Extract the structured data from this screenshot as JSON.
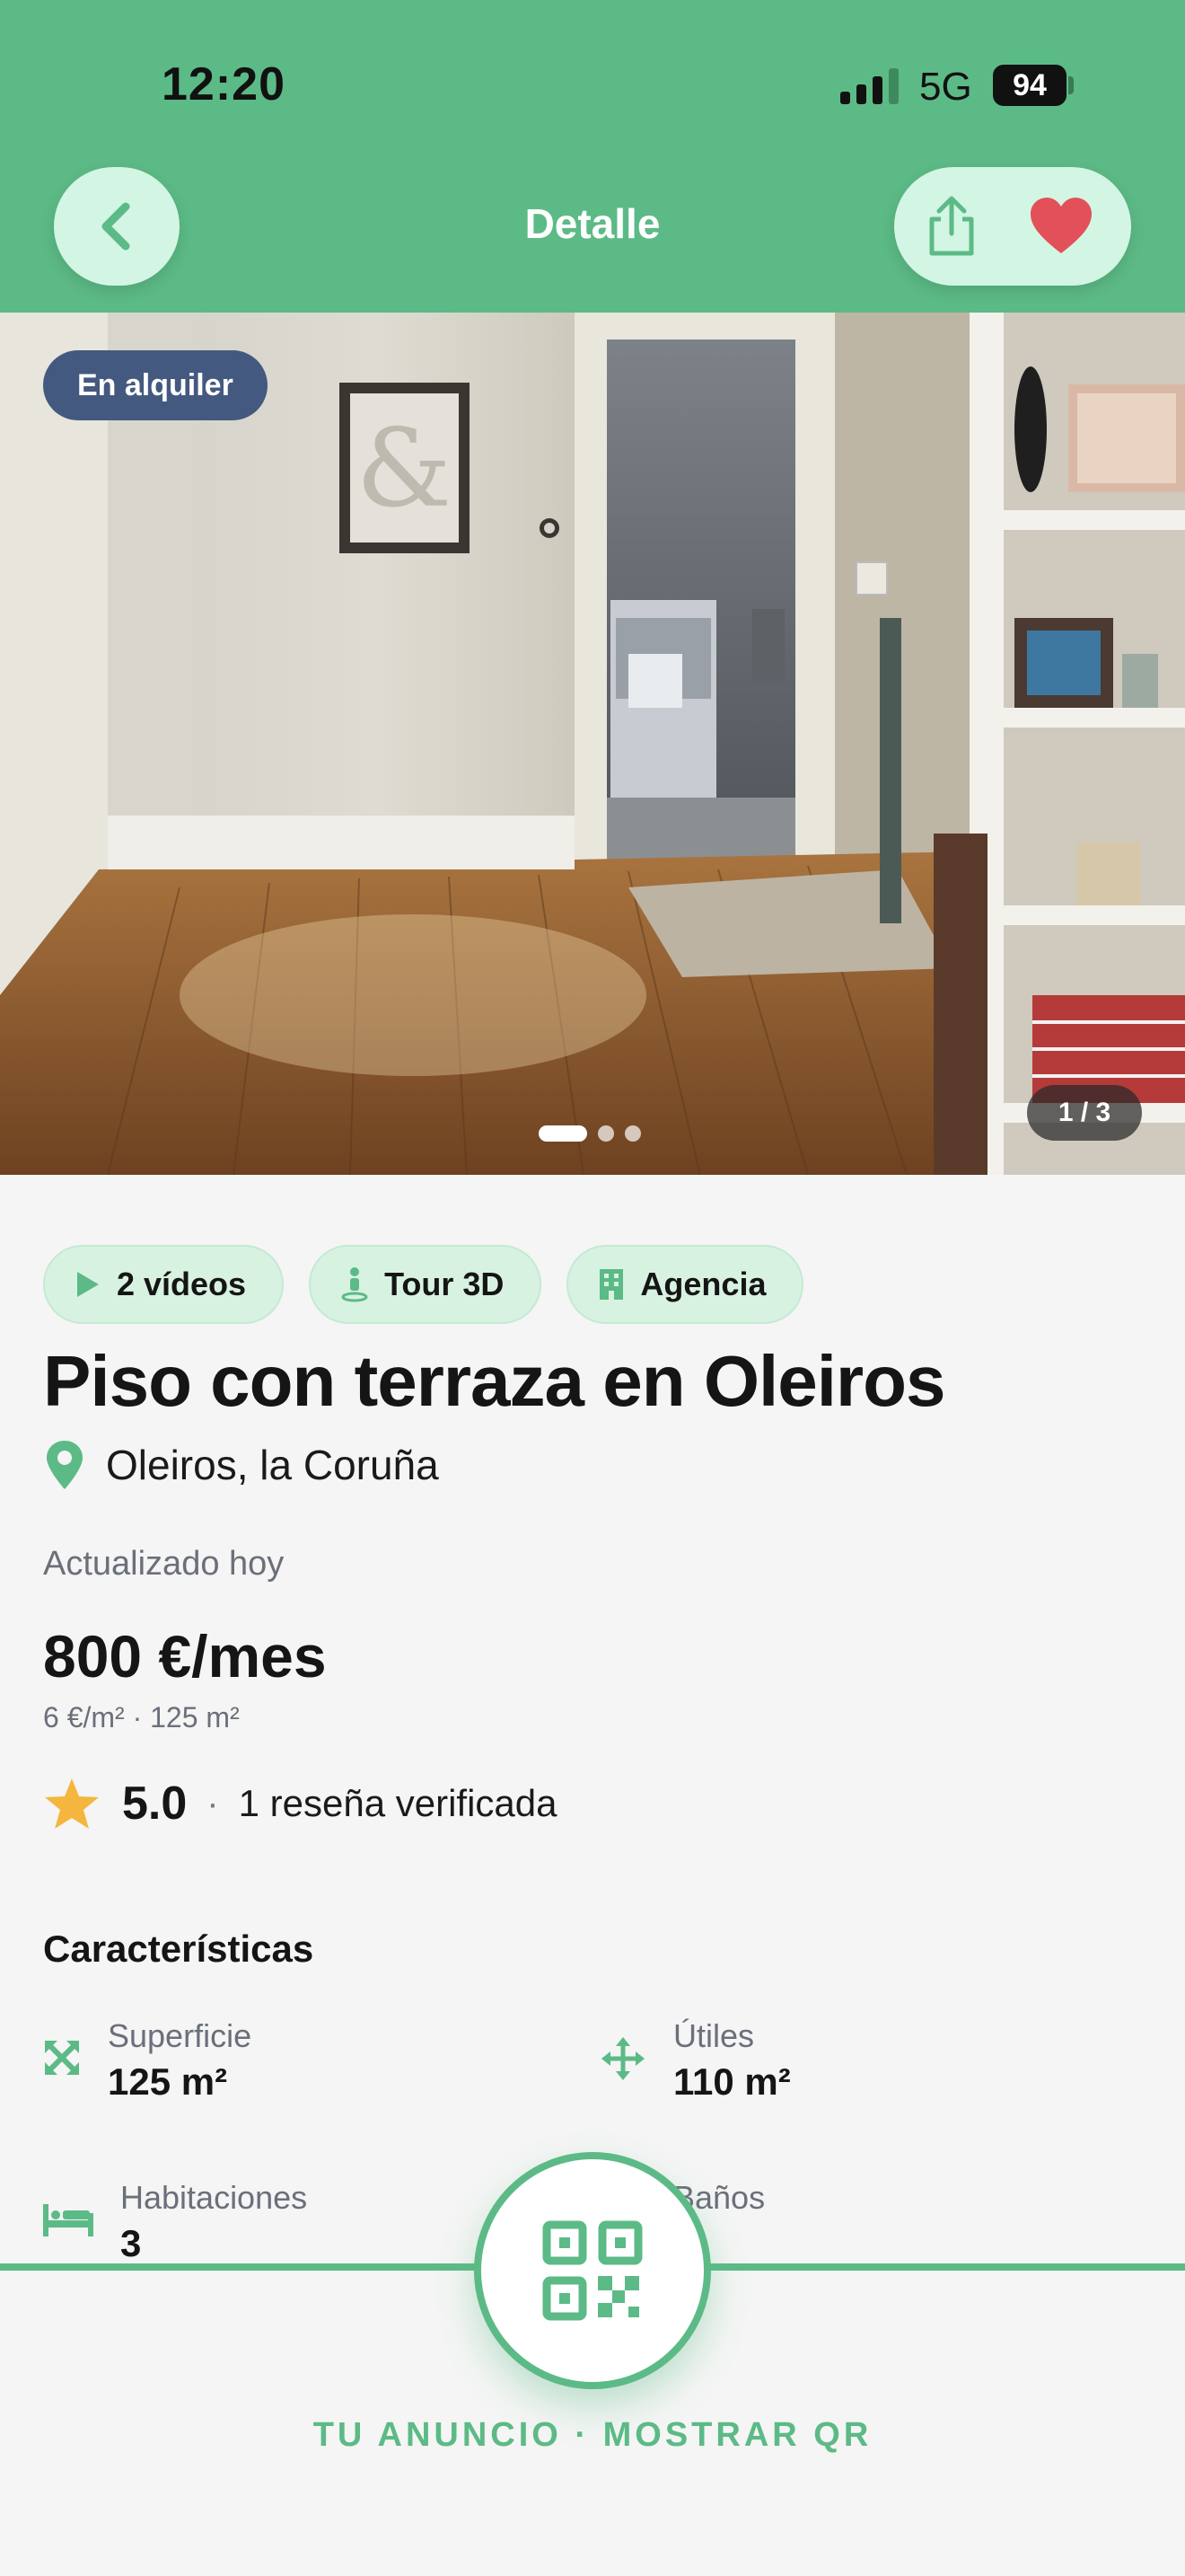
{
  "status_bar": {
    "time": "12:20",
    "network": "5G",
    "battery": "94"
  },
  "header": {
    "title": "Detalle",
    "back_icon": "chevron-left-icon",
    "share_icon": "share-icon",
    "favorite_icon": "heart-icon"
  },
  "gallery": {
    "badge": "En alquiler",
    "counter": "1 / 3",
    "current_index": 1,
    "total": 3
  },
  "chips": [
    {
      "icon": "play-icon",
      "label": "2 vídeos"
    },
    {
      "icon": "person-pin-icon",
      "label": "Tour 3D"
    },
    {
      "icon": "building-icon",
      "label": "Agencia"
    }
  ],
  "listing": {
    "title": "Piso con terraza en Oleiros",
    "location": "Oleiros, la Coruña",
    "updated": "Actualizado hoy",
    "price": "800 €/mes",
    "price_details": "6 €/m² · 125 m²",
    "rating": "5.0",
    "rating_separator": "·",
    "reviews": "1 reseña verificada"
  },
  "features": {
    "title": "Características",
    "items": [
      {
        "icon": "expand-arrows-icon",
        "label": "Superficie",
        "value": "125 m²"
      },
      {
        "icon": "move-arrows-icon",
        "label": "Útiles",
        "value": "110 m²"
      },
      {
        "icon": "bed-icon",
        "label": "Habitaciones",
        "value": "3"
      },
      {
        "icon": "bath-icon",
        "label": "Baños",
        "value": ""
      }
    ]
  },
  "qr": {
    "label": "TU ANUNCIO · MOSTRAR QR",
    "icon": "qr-code-icon"
  },
  "colors": {
    "brand": "#5cba86",
    "pill_bg": "#d3f5e3",
    "badge": "#44597f",
    "heart": "#e2505a",
    "star": "#f4b63e"
  }
}
